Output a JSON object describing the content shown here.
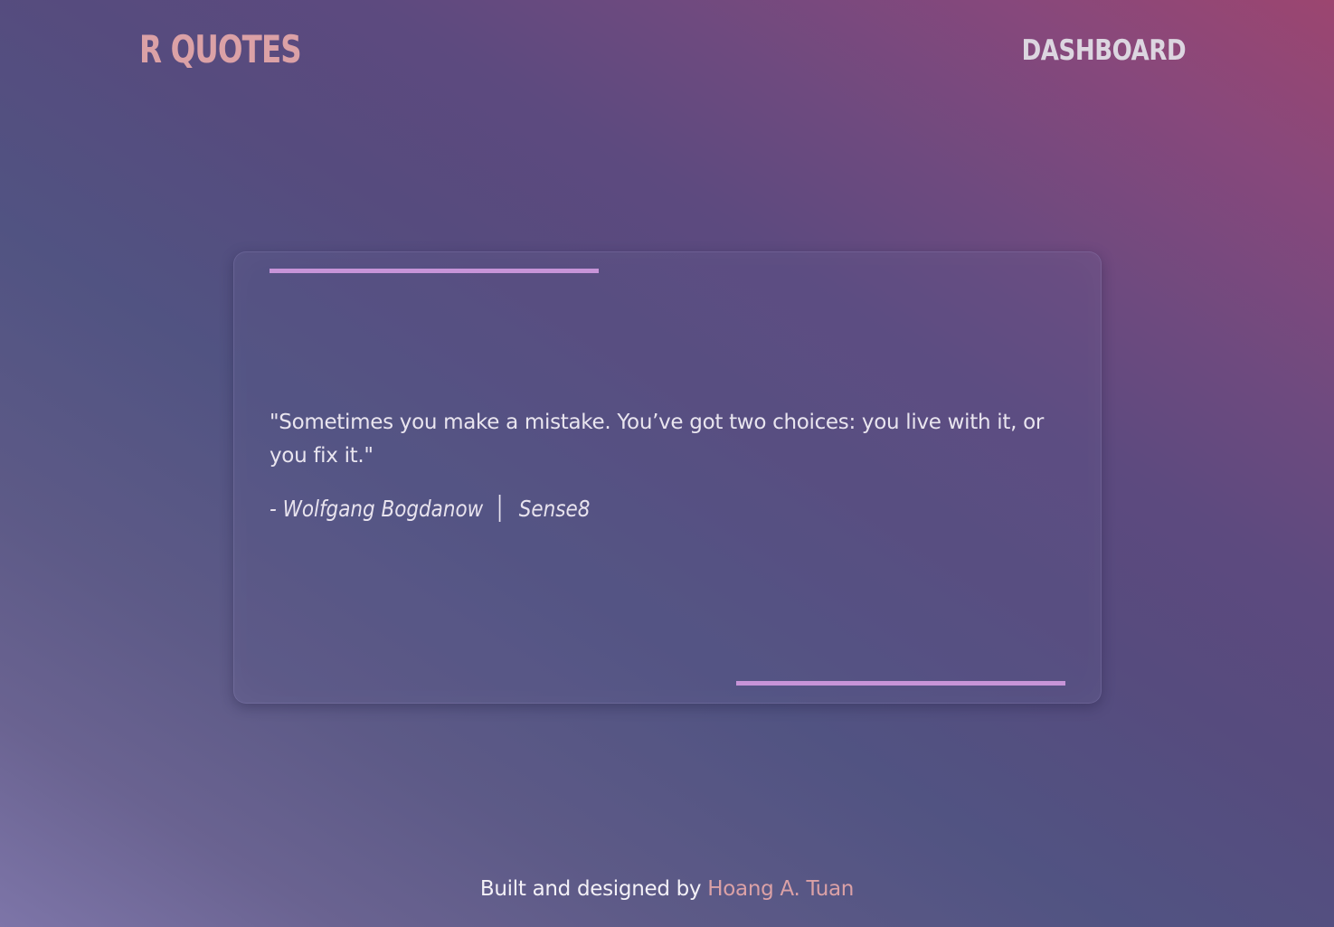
{
  "header": {
    "logo": "R QUOTES",
    "nav": {
      "dashboard_label": "DASHBOARD"
    }
  },
  "quote": {
    "text": "\"Sometimes you make a mistake. You’ve got two choices: you live with it, or you fix it.\"",
    "author": "- Wolfgang Bogdanow",
    "source": "Sense8"
  },
  "footer": {
    "prefix": "Built and designed by",
    "author_link": "Hoang A. Tuan"
  },
  "colors": {
    "logo": "#dba1a6",
    "accent_line": "#c794d8",
    "footer_link": "#dba1a6",
    "gradient_start": "#7d75a8",
    "gradient_end": "#9c4670"
  }
}
